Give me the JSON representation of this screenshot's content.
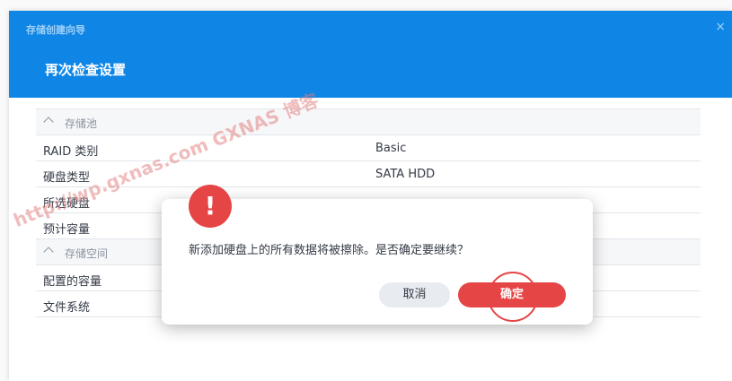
{
  "window": {
    "title": "存储创建向导",
    "close_icon": "×",
    "heading": "再次检查设置"
  },
  "settings": {
    "section_pool": "存储池",
    "section_space": "存储空间",
    "rows": [
      {
        "label": "RAID 类别",
        "value": "Basic"
      },
      {
        "label": "硬盘类型",
        "value": "SATA HDD"
      },
      {
        "label": "所选硬盘",
        "value": ""
      },
      {
        "label": "预计容量",
        "value": ""
      },
      {
        "label": "配置的容量",
        "value": ""
      },
      {
        "label": "文件系统",
        "value": ""
      }
    ]
  },
  "watermark": "http://wp.gxnas.com   GXNAS 博客",
  "dialog": {
    "alert_icon": "!",
    "message": "新添加硬盘上的所有数据将被擦除。是否确定要继续？",
    "cancel_label": "取消",
    "ok_label": "确定"
  },
  "colors": {
    "header_bg": "#0f86e6",
    "danger": "#e64545",
    "cancel_bg": "#e8ebf0"
  },
  "icons": {
    "close": "close-icon",
    "section_toggle": "chevron-up-icon",
    "alert": "alert-icon"
  }
}
